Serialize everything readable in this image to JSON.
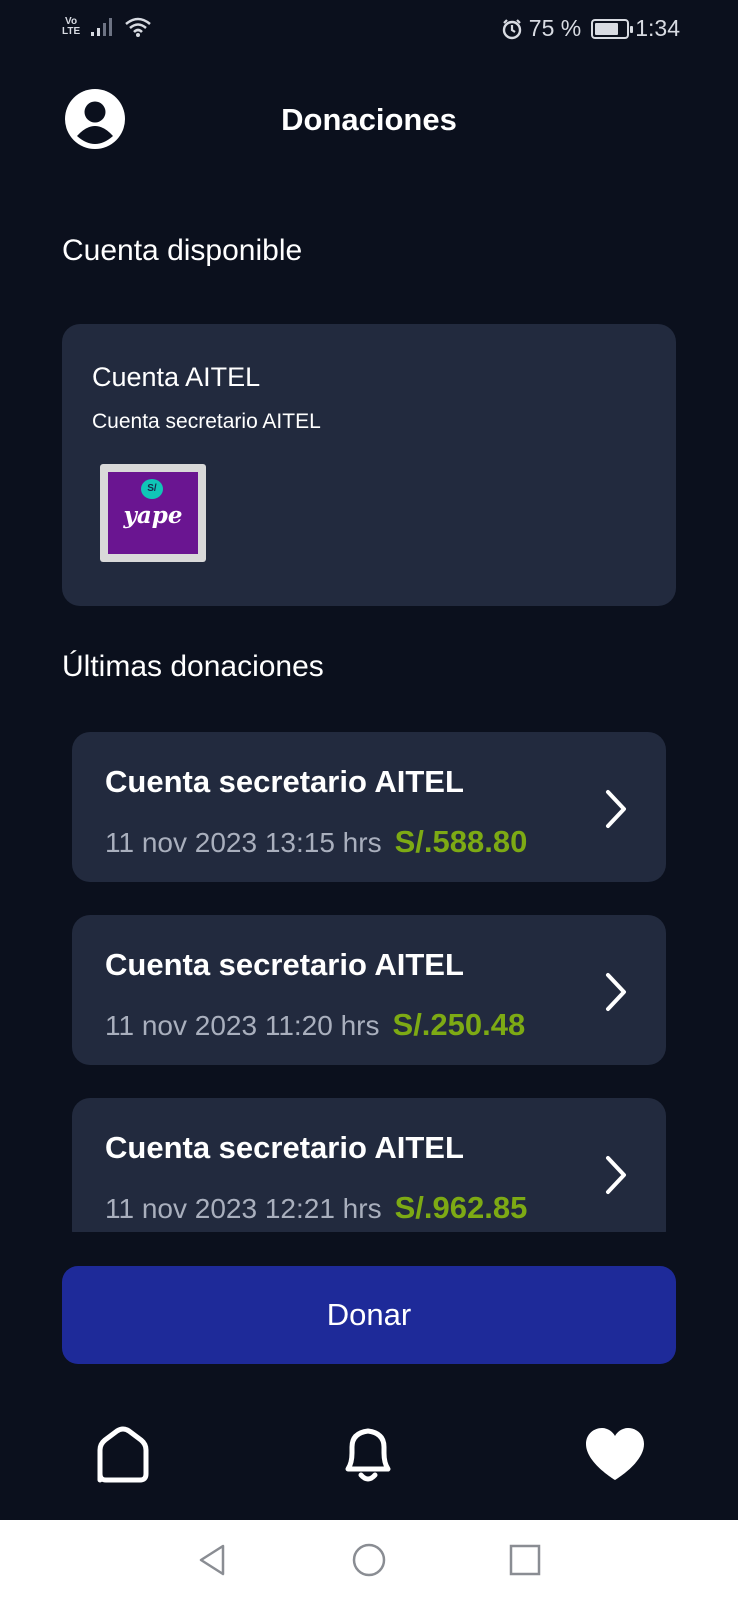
{
  "status_bar": {
    "network_top": "Vo",
    "network_bottom": "LTE",
    "battery_label": "75 %",
    "battery_level": 0.75,
    "time": "1:34",
    "icons": [
      "signal-icon",
      "wifi-icon",
      "alarm-icon",
      "battery-icon"
    ]
  },
  "header": {
    "title": "Donaciones",
    "avatar_icon": "user-avatar-icon"
  },
  "available_account": {
    "section_title": "Cuenta disponible",
    "name": "Cuenta AITEL",
    "description": "Cuenta secretario AITEL",
    "logo_text": "yape",
    "logo_badge": "S/"
  },
  "recent": {
    "section_title": "Últimas donaciones",
    "items": [
      {
        "title": "Cuenta secretario AITEL",
        "date": "11 nov 2023 13:15 hrs",
        "amount": "S/.588.80"
      },
      {
        "title": "Cuenta secretario AITEL",
        "date": "11 nov 2023 11:20 hrs",
        "amount": "S/.250.48"
      },
      {
        "title": "Cuenta secretario AITEL",
        "date": "11 nov 2023 12:21 hrs",
        "amount": "S/.962.85"
      }
    ]
  },
  "donate_button": {
    "label": "Donar"
  },
  "bottom_nav": {
    "items": [
      {
        "icon": "home-icon"
      },
      {
        "icon": "bell-icon"
      },
      {
        "icon": "heart-icon"
      }
    ]
  },
  "system_nav": {
    "items": [
      {
        "icon": "back-icon"
      },
      {
        "icon": "home-circle-icon"
      },
      {
        "icon": "recents-icon"
      }
    ]
  },
  "colors": {
    "background": "#0b101d",
    "card": "#222a3e",
    "amount": "#7daa14",
    "button": "#1e2a99",
    "brand_yape": "#6a1591"
  }
}
